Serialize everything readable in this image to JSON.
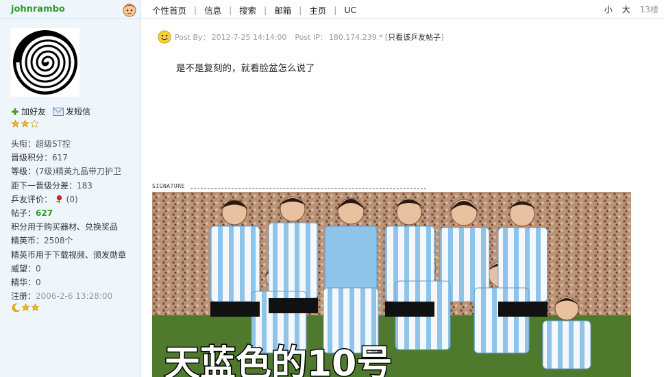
{
  "user": {
    "name": "johnrambo",
    "actions": {
      "add_friend": "加好友",
      "send_msg": "发短信"
    },
    "info": [
      {
        "k": "头衔：",
        "v": "超级ST控",
        "style": ""
      },
      {
        "k": "晋级积分：",
        "v": "617",
        "style": ""
      },
      {
        "k": "等级：",
        "v": "(7级)精英九品带刀护卫",
        "style": "c-red"
      },
      {
        "k": "距下一晋级分差：",
        "v": "183",
        "style": ""
      },
      {
        "k": "乒友评价：",
        "v": "(0)",
        "style": ""
      },
      {
        "k": "帖子：",
        "v": "627",
        "style": "c-green"
      },
      {
        "k": "",
        "v": "积分用于购买器材、兑换奖品",
        "style": "c-purple"
      },
      {
        "k": "精英币：",
        "v": "2508个",
        "style": ""
      },
      {
        "k": "",
        "v": "精英币用于下载视频、颁发勋章",
        "style": "c-orange"
      },
      {
        "k": "威望：",
        "v": "0",
        "style": ""
      },
      {
        "k": "精华：",
        "v": "0",
        "style": ""
      },
      {
        "k": "注册：",
        "v": "2006-2-6 13:28:00",
        "style": "c-gray"
      }
    ]
  },
  "nav": {
    "links": [
      "个性首页",
      "信息",
      "搜索",
      "邮箱",
      "主页",
      "UC"
    ],
    "small": "小",
    "large": "大",
    "floor": "13楼"
  },
  "post": {
    "post_by_label": "Post By：",
    "post_time": "2012-7-25 14:14:00",
    "post_ip_label": "Post IP：",
    "post_ip": "180.174.239.*",
    "only_this_user": "只看该乒友帖子",
    "bracket_open": "[",
    "bracket_close": "]",
    "content": "是不是复刻的，就看脸盆怎么说了",
    "signature_label": "SIGNATURE",
    "banner_text": "天蓝色的10号"
  },
  "colors": {
    "username": "#2f9a2b",
    "panel_bg": "#eef5fb",
    "level": "#c00000",
    "purple_note": "#c0207f",
    "orange_note": "#e06000",
    "stripe": "#8fc4ea"
  }
}
